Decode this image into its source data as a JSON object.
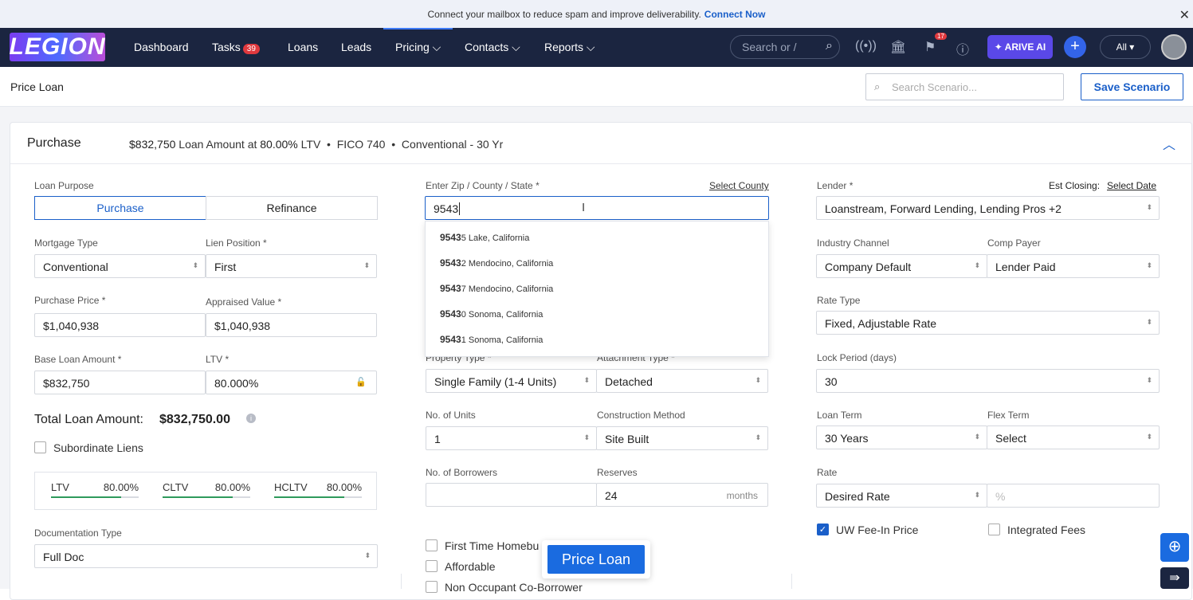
{
  "banner": {
    "text": "Connect your mailbox to reduce spam and improve deliverability.",
    "link": "Connect Now",
    "close": "✕"
  },
  "nav": {
    "logo": "LEGION",
    "items": [
      {
        "label": "Dashboard"
      },
      {
        "label": "Tasks",
        "badge": "39"
      },
      {
        "label": "Loans"
      },
      {
        "label": "Leads"
      },
      {
        "label": "Pricing ⌵"
      },
      {
        "label": "Contacts ⌵"
      },
      {
        "label": "Reports ⌵"
      }
    ],
    "search_placeholder": "Search or /",
    "notif_badge": "17",
    "arrive": "✦ ARIVE AI",
    "all": "All ▾"
  },
  "subheader": {
    "title": "Price Loan",
    "search_placeholder": "Search Scenario...",
    "save": "Save Scenario"
  },
  "summary": {
    "title": "Purchase",
    "amount": "$832,750",
    "amount_text": "Loan Amount at",
    "ltv": "80.00%",
    "ltv_text": "LTV",
    "fico": "FICO 740",
    "product": "Conventional",
    "term": "- 30 Yr"
  },
  "left": {
    "loan_purpose_label": "Loan Purpose",
    "purpose_options": [
      "Purchase",
      "Refinance"
    ],
    "mortgage_type_label": "Mortgage Type",
    "mortgage_type": "Conventional",
    "lien_label": "Lien Position *",
    "lien": "First",
    "purchase_price_label": "Purchase Price *",
    "purchase_price": "$1,040,938",
    "appraised_label": "Appraised Value *",
    "appraised": "$1,040,938",
    "base_loan_label": "Base Loan Amount *",
    "base_loan": "$832,750",
    "ltv_label": "LTV *",
    "ltv": "80.000%",
    "total_label": "Total Loan Amount:",
    "total": "$832,750.00",
    "subordinate": "Subordinate Liens",
    "ratios": [
      {
        "label": "LTV",
        "value": "80.00%",
        "fill": 0.8
      },
      {
        "label": "CLTV",
        "value": "80.00%",
        "fill": 0.8
      },
      {
        "label": "HCLTV",
        "value": "80.00%",
        "fill": 0.8
      }
    ],
    "doc_type_label": "Documentation Type",
    "doc_type": "Full Doc"
  },
  "middle": {
    "zip_label": "Enter Zip / County / State *",
    "select_county": "Select County",
    "zip_value": "9543",
    "suggestions": [
      {
        "bold": "9543",
        "rest": "5 Lake, California"
      },
      {
        "bold": "9543",
        "rest": "2 Mendocino, California"
      },
      {
        "bold": "9543",
        "rest": "7 Mendocino, California"
      },
      {
        "bold": "9543",
        "rest": "0 Sonoma, California"
      },
      {
        "bold": "9543",
        "rest": "1 Sonoma, California"
      }
    ],
    "property_type_label": "Property Type *",
    "property_type": "Single Family (1-4 Units)",
    "attachment_label": "Attachment Type *",
    "attachment": "Detached",
    "units_label": "No. of Units",
    "units": "1",
    "construction_label": "Construction Method",
    "construction": "Site Built",
    "borrowers_label": "No. of Borrowers",
    "borrowers": "",
    "reserves_label": "Reserves",
    "reserves": "24",
    "reserves_unit": "months",
    "checks": [
      "First Time Homebu",
      "Affordable",
      "Non Occupant Co-Borrower"
    ],
    "price_button": "Price Loan"
  },
  "right": {
    "lender_label": "Lender *",
    "est_closing": "Est Closing:",
    "select_date": "Select Date",
    "lender": "Loanstream, Forward Lending, Lending Pros +2",
    "channel_label": "Industry Channel",
    "channel": "Company Default",
    "comp_label": "Comp Payer",
    "comp": "Lender Paid",
    "rate_type_label": "Rate Type",
    "rate_type": "Fixed, Adjustable Rate",
    "lock_label": "Lock Period (days)",
    "lock": "30",
    "term_label": "Loan Term",
    "term": "30 Years",
    "flex_label": "Flex Term",
    "flex": "Select",
    "rate_label": "Rate",
    "rate": "Desired Rate",
    "rate_placeholder": "%",
    "uw_fee": "UW Fee-In Price",
    "integrated": "Integrated Fees"
  }
}
